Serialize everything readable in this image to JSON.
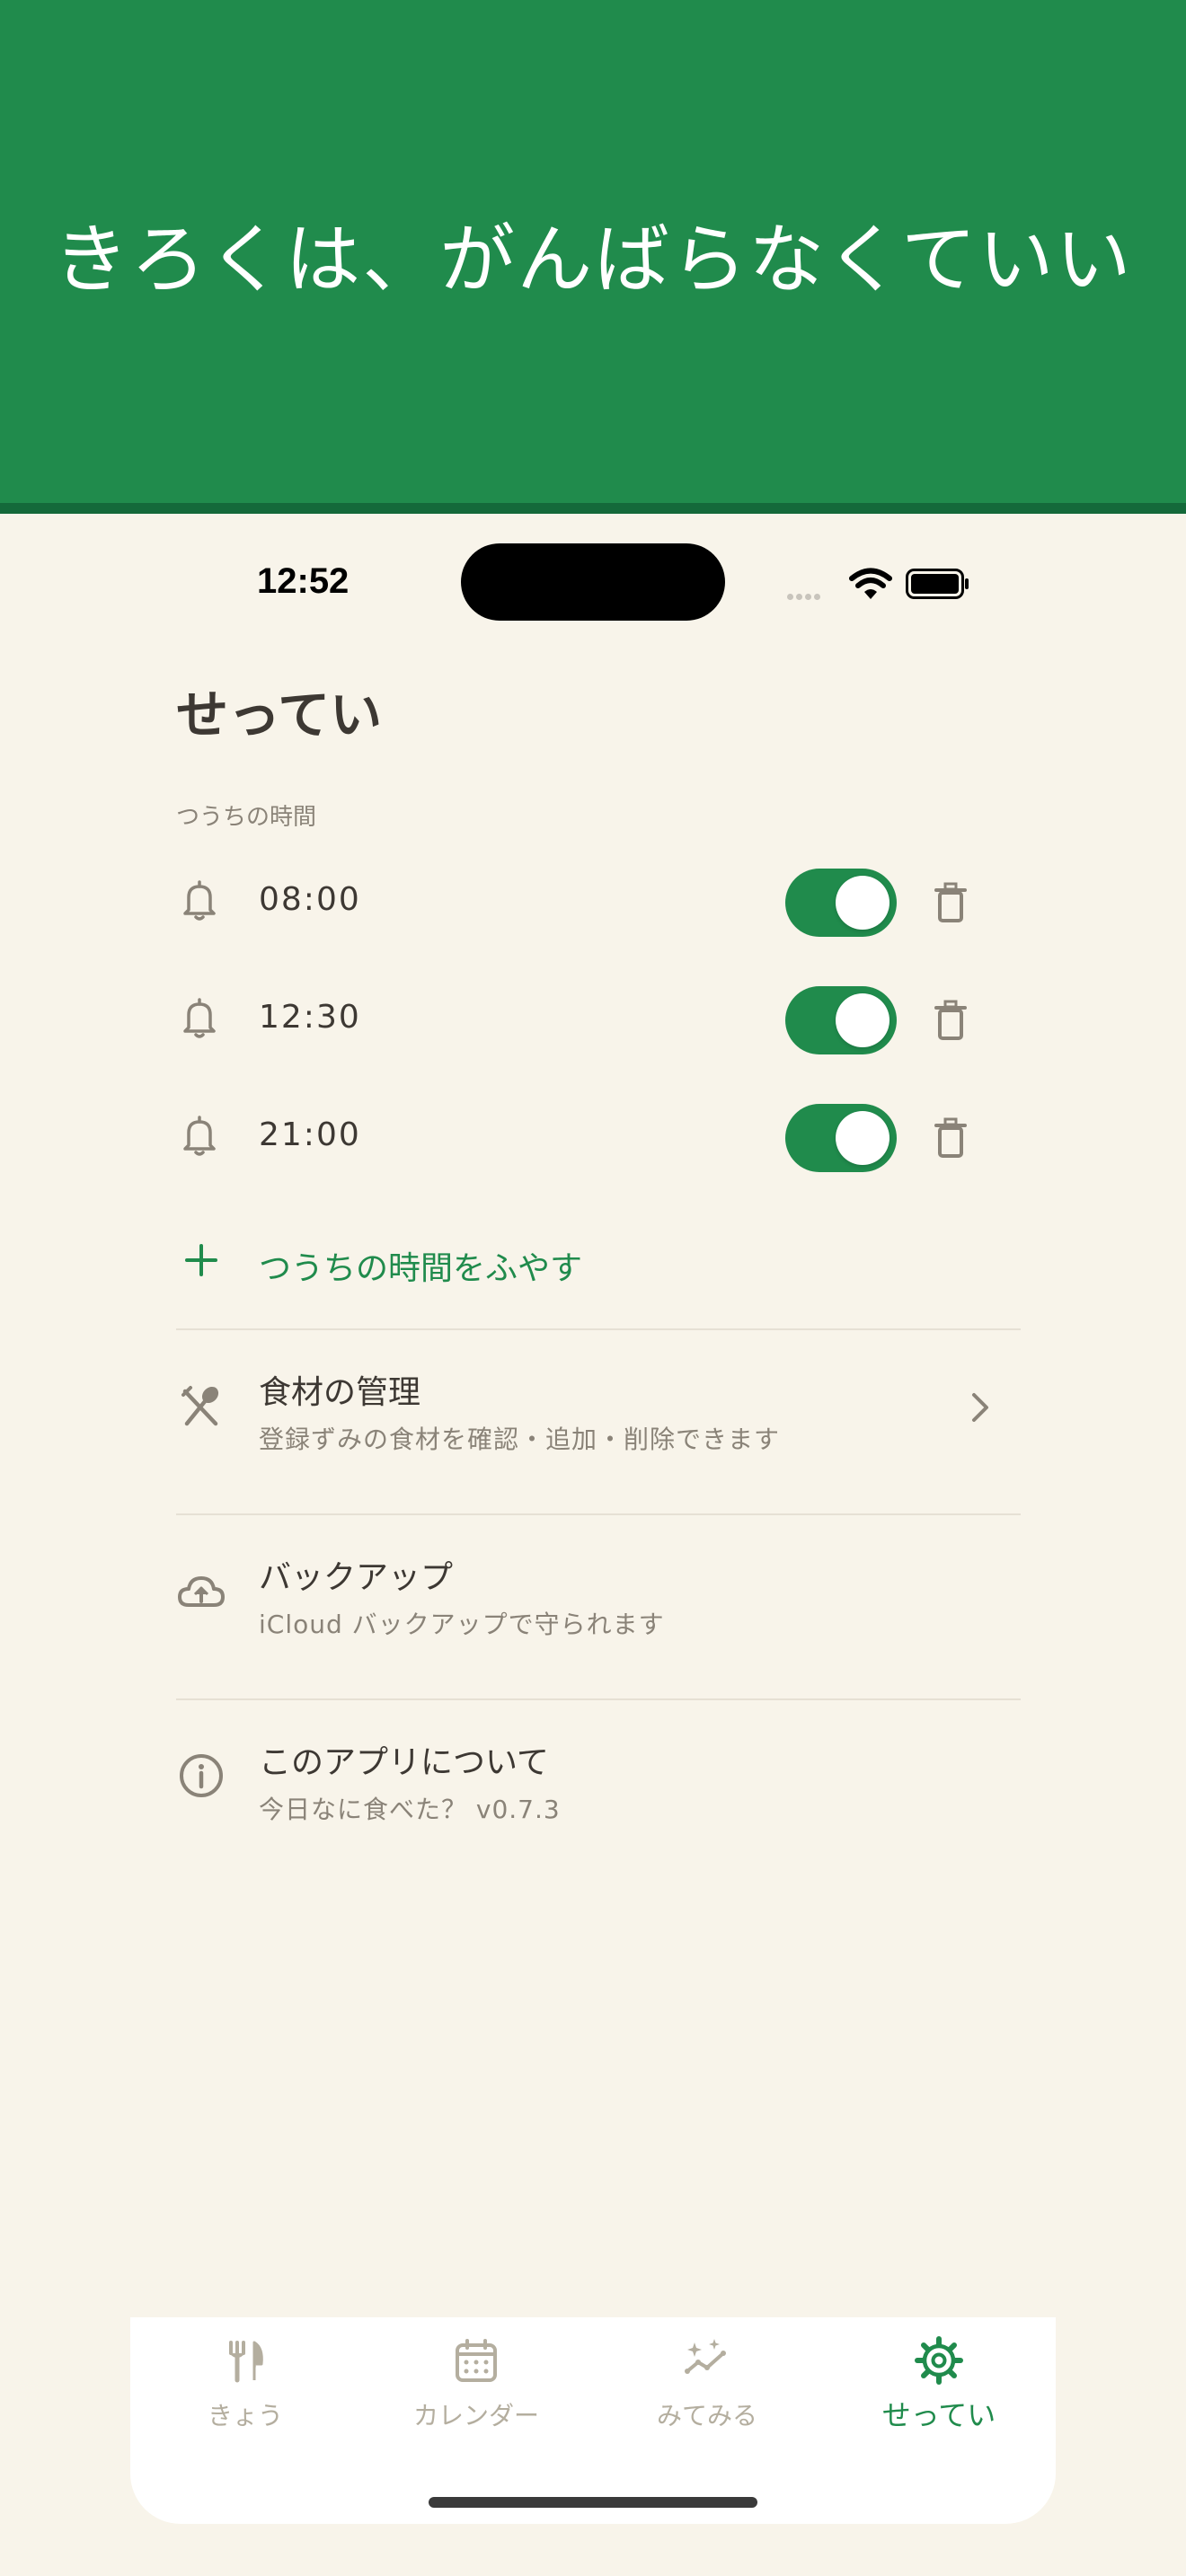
{
  "banner": {
    "text": "きろくは、がんばらなくていい"
  },
  "status_bar": {
    "time": "12:52"
  },
  "page": {
    "title": "せってい"
  },
  "notifications": {
    "section_label": "つうちの時間",
    "items": [
      {
        "time": "08:00",
        "enabled": true
      },
      {
        "time": "12:30",
        "enabled": true
      },
      {
        "time": "21:00",
        "enabled": true
      }
    ],
    "add_label": "つうちの時間をふやす"
  },
  "menu": {
    "ingredients": {
      "title": "食材の管理",
      "subtitle": "登録ずみの食材を確認・追加・削除できます",
      "icon": "fork-spoon-icon"
    },
    "backup": {
      "title": "バックアップ",
      "subtitle": "iCloud バックアップで守られます",
      "icon": "cloud-upload-icon"
    },
    "about": {
      "title": "このアプリについて",
      "subtitle": "今日なに食べた？ v0.7.3",
      "icon": "info-icon"
    }
  },
  "tabs": [
    {
      "label": "きょう",
      "icon": "fork-knife-icon",
      "active": false
    },
    {
      "label": "カレンダー",
      "icon": "calendar-icon",
      "active": false
    },
    {
      "label": "みてみる",
      "icon": "chart-sparkle-icon",
      "active": false
    },
    {
      "label": "せってい",
      "icon": "gear-icon",
      "active": true
    }
  ],
  "colors": {
    "accent": "#208b4c",
    "background": "#f8f4ea",
    "text": "#3d3833",
    "muted": "#8a8378",
    "tab_inactive": "#b4ae9f"
  }
}
